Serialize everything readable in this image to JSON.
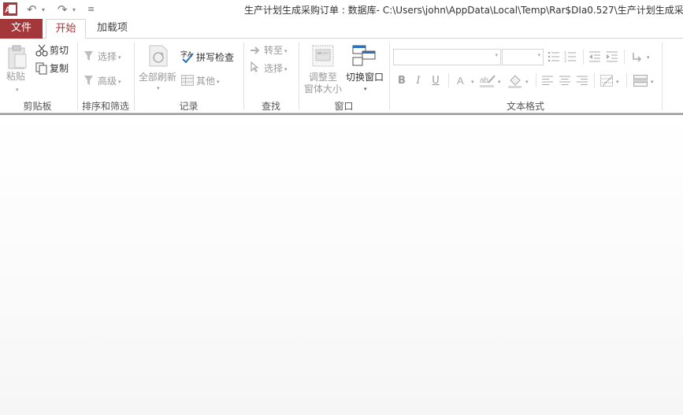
{
  "titlebar": {
    "title": "生产计划生成采购订单 : 数据库- C:\\Users\\john\\AppData\\Local\\Temp\\Rar$DIa0.527\\生产计划生成采购"
  },
  "tabs": [
    {
      "label": "文件"
    },
    {
      "label": "开始"
    },
    {
      "label": "加载项"
    }
  ],
  "clipboard": {
    "paste": "粘贴",
    "cut": "剪切",
    "copy": "复制",
    "group": "剪贴板"
  },
  "sort_filter": {
    "select": "选择",
    "advanced": "高级",
    "group": "排序和筛选"
  },
  "records": {
    "refresh_all": "全部刷新",
    "spell_check": "拼写检查",
    "more": "其他",
    "group": "记录"
  },
  "find": {
    "goto": "转至",
    "select": "选择",
    "group": "查找"
  },
  "window": {
    "size_to_fit_line1": "调整至",
    "size_to_fit_line2": "窗体大小",
    "switch_windows": "切换窗口",
    "group": "窗口"
  },
  "text_format": {
    "bold": "B",
    "italic": "I",
    "underline": "U",
    "group": "文本格式"
  },
  "colors": {
    "accent": "#a4373a",
    "disabled": "#9a9a9a"
  }
}
